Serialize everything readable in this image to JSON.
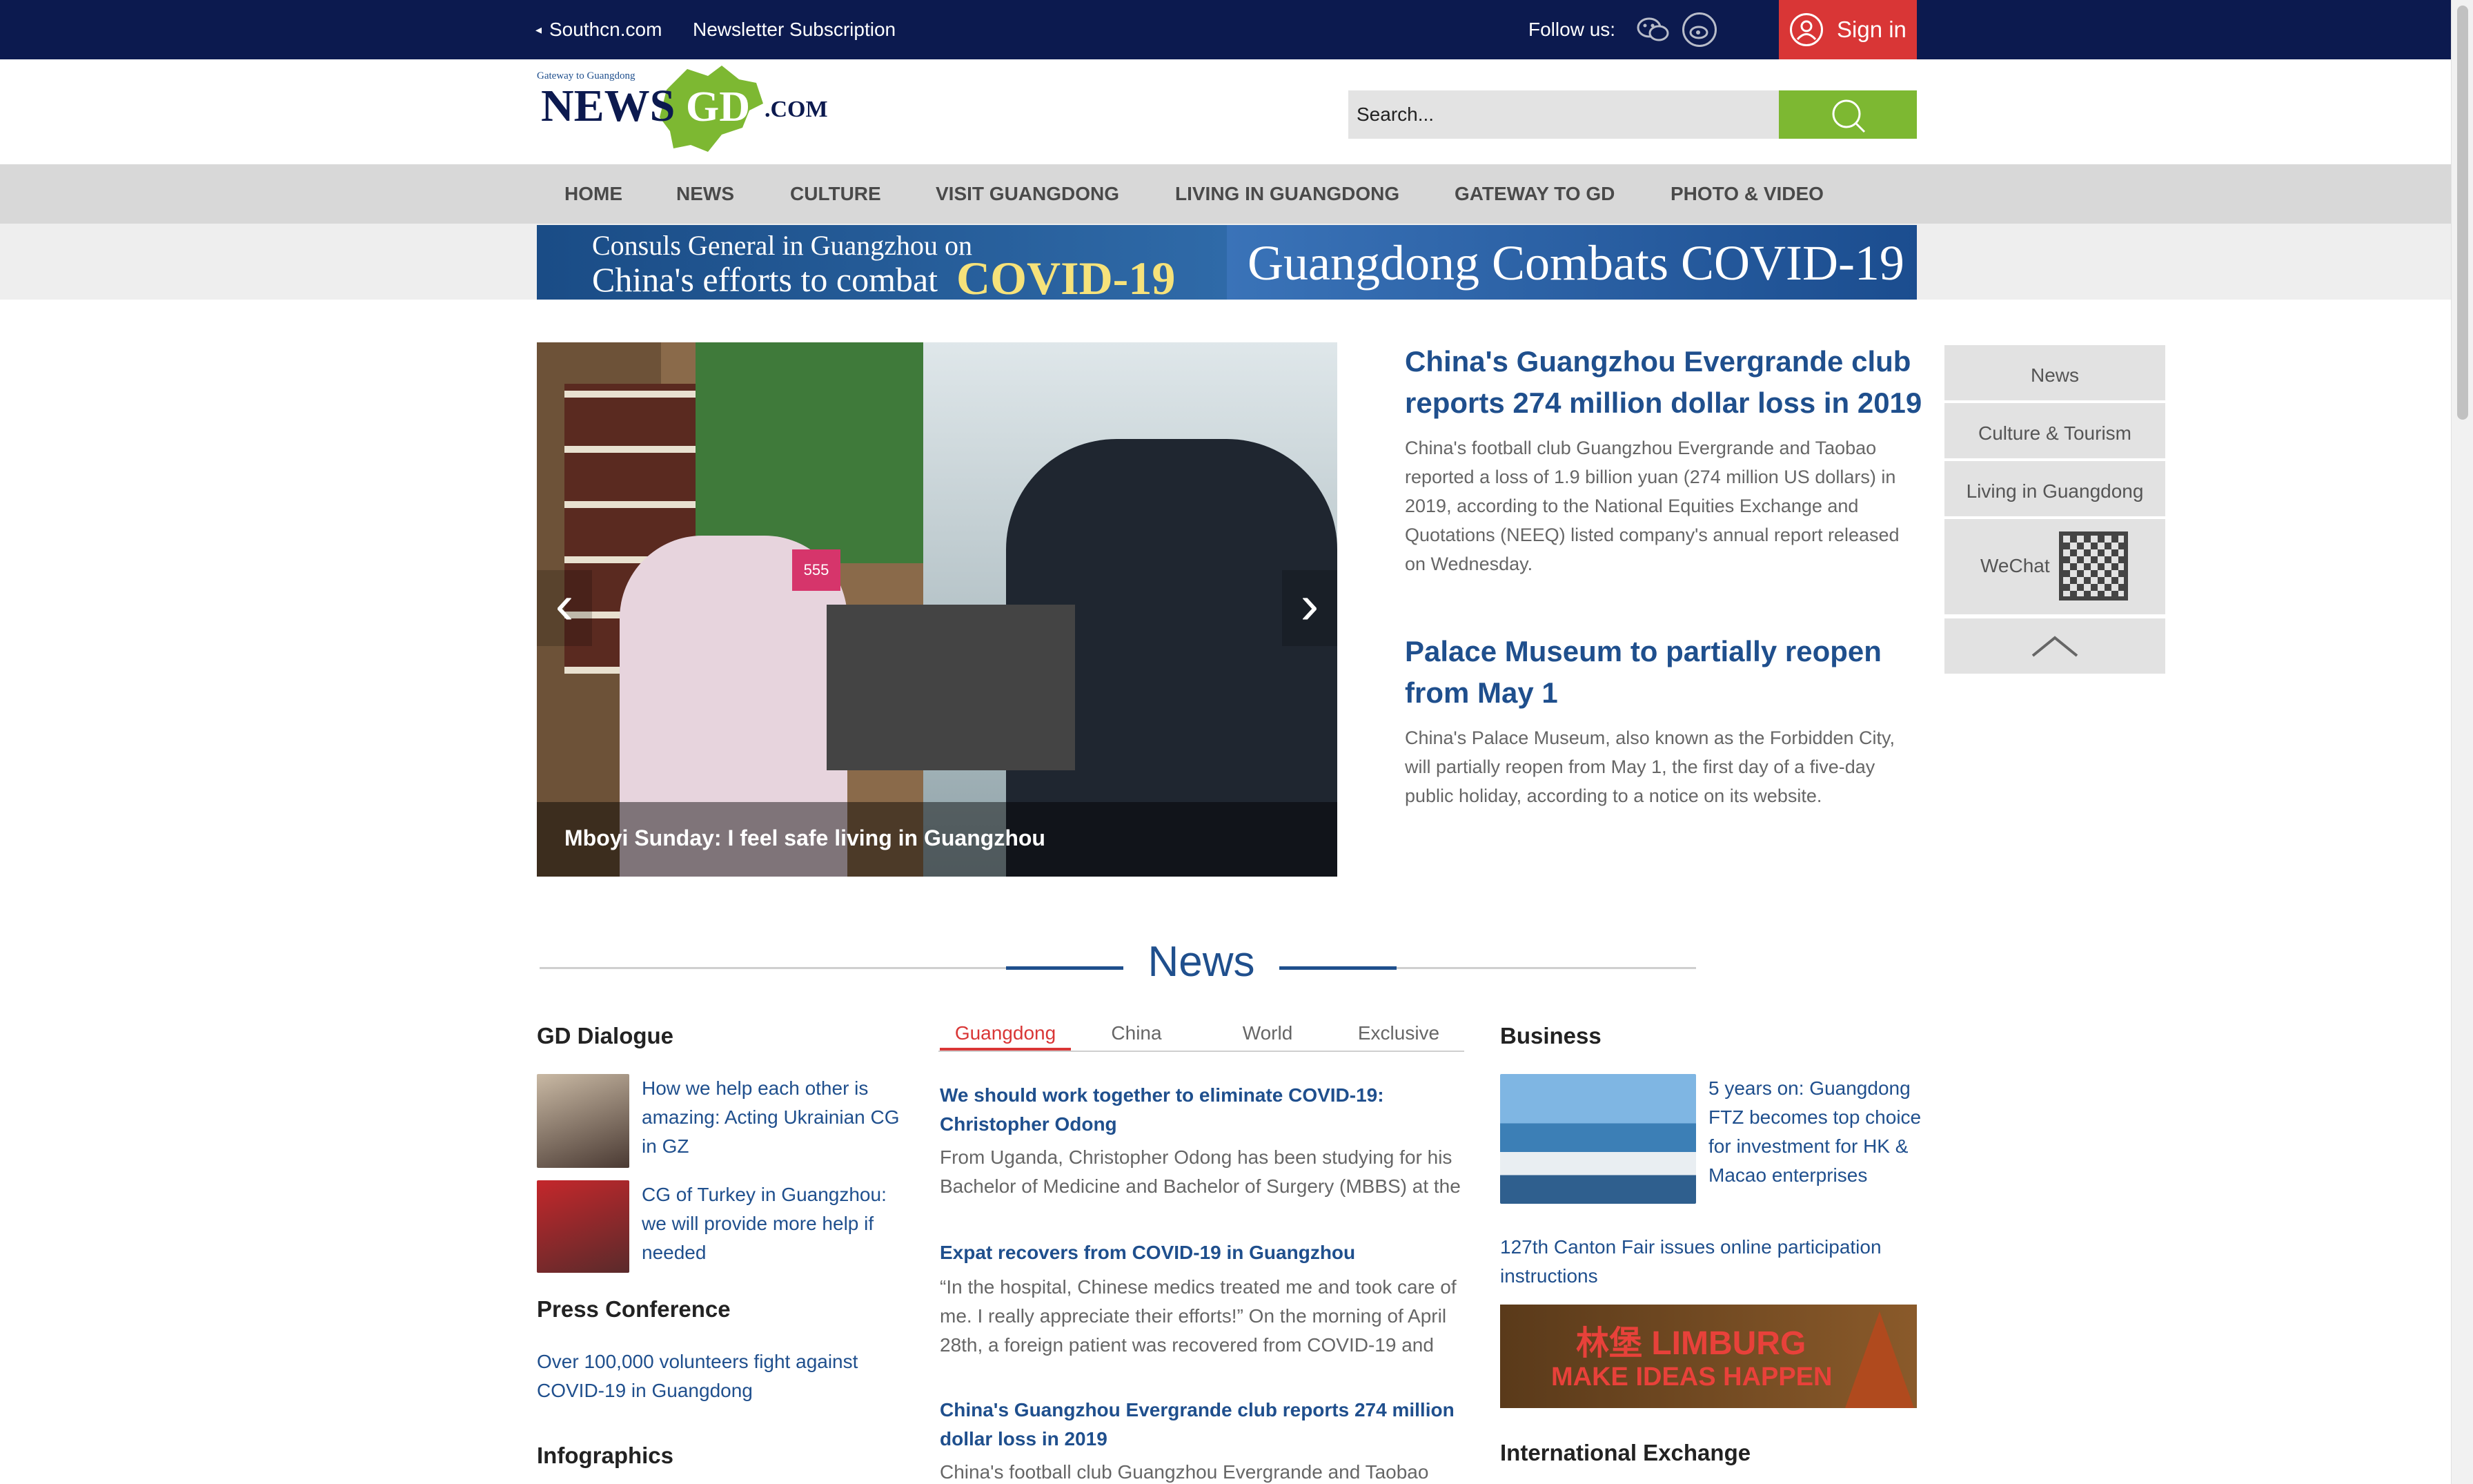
{
  "topbar": {
    "southcn": "Southcn.com",
    "newsletter": "Newsletter Subscription",
    "follow_label": "Follow us:",
    "sign_in": "Sign in"
  },
  "header": {
    "logo_tagline": "Gateway to Guangdong",
    "logo_news": "NEWS",
    "logo_gd": "GD",
    "logo_com": ".COM",
    "search_placeholder": "Search..."
  },
  "nav": [
    "HOME",
    "NEWS",
    "CULTURE",
    "VISIT GUANGDONG",
    "LIVING IN GUANGDONG",
    "GATEWAY TO GD",
    "PHOTO & VIDEO"
  ],
  "banner": {
    "left_line1": "Consuls General in Guangzhou on",
    "left_line2": "China's efforts to combat",
    "left_covid": "COVID-19",
    "right": "Guangdong Combats COVID-19"
  },
  "slider": {
    "caption": "Mboyi Sunday: I feel safe living in Guangzhou",
    "store_sign": "555"
  },
  "headlines": [
    {
      "title": "China's Guangzhou Evergrande club reports 274 million dollar loss in 2019",
      "desc": "China's football club Guangzhou Evergrande and Taobao reported a loss of 1.9 billion yuan (274 million US dollars) in 2019, according to the National Equities Exchange and Quotations (NEEQ) listed company's annual report released on Wednesday."
    },
    {
      "title": "Palace Museum to partially reopen from May 1",
      "desc": "China's Palace Museum, also known as the Forbidden City, will partially reopen from May 1, the first day of a five-day public holiday, according to a notice on its website."
    }
  ],
  "sidebar": {
    "news": "News",
    "culture": "Culture & Tourism",
    "living": "Living in Guangdong",
    "wechat": "WeChat"
  },
  "news_section": {
    "title": "News",
    "gd_dialogue": {
      "heading": "GD Dialogue",
      "items": [
        "How we help each other is amazing: Acting Ukrainian CG in GZ",
        "CG of Turkey in Guangzhou: we will provide more help if needed"
      ]
    },
    "press_conference": {
      "heading": "Press Conference",
      "item": "Over 100,000 volunteers fight against COVID-19 in Guangdong"
    },
    "infographics": "Infographics",
    "tabs": [
      "Guangdong",
      "China",
      "World",
      "Exclusive"
    ],
    "stories": [
      {
        "title": "We should work together to eliminate COVID-19: Christopher Odong",
        "desc": "From Uganda, Christopher Odong has been studying for his Bachelor of Medicine and Bachelor of Surgery (MBBS) at the"
      },
      {
        "title": "Expat recovers from COVID-19 in Guangzhou",
        "desc": "“In the hospital, Chinese medics treated me and took care of me. I really appreciate their efforts!” On the morning of April 28th, a foreign patient was recovered from COVID-19 and"
      },
      {
        "title": "China's Guangzhou Evergrande club reports 274 million dollar loss in 2019",
        "desc": "China's football club Guangzhou Evergrande and Taobao"
      }
    ],
    "business": {
      "heading": "Business",
      "item1": "5 years on: Guangdong FTZ becomes top choice for investment for HK & Macao enterprises",
      "item2": "127th Canton Fair issues online participation instructions",
      "ad_line1": "林堡 LIMBURG",
      "ad_line2": "MAKE IDEAS HAPPEN"
    },
    "international_exchange": "International Exchange"
  },
  "colors": {
    "topbar": "#0c1a4f",
    "accent_red": "#d93636",
    "search_green": "#7db832",
    "link_blue": "#1f4f8d"
  }
}
